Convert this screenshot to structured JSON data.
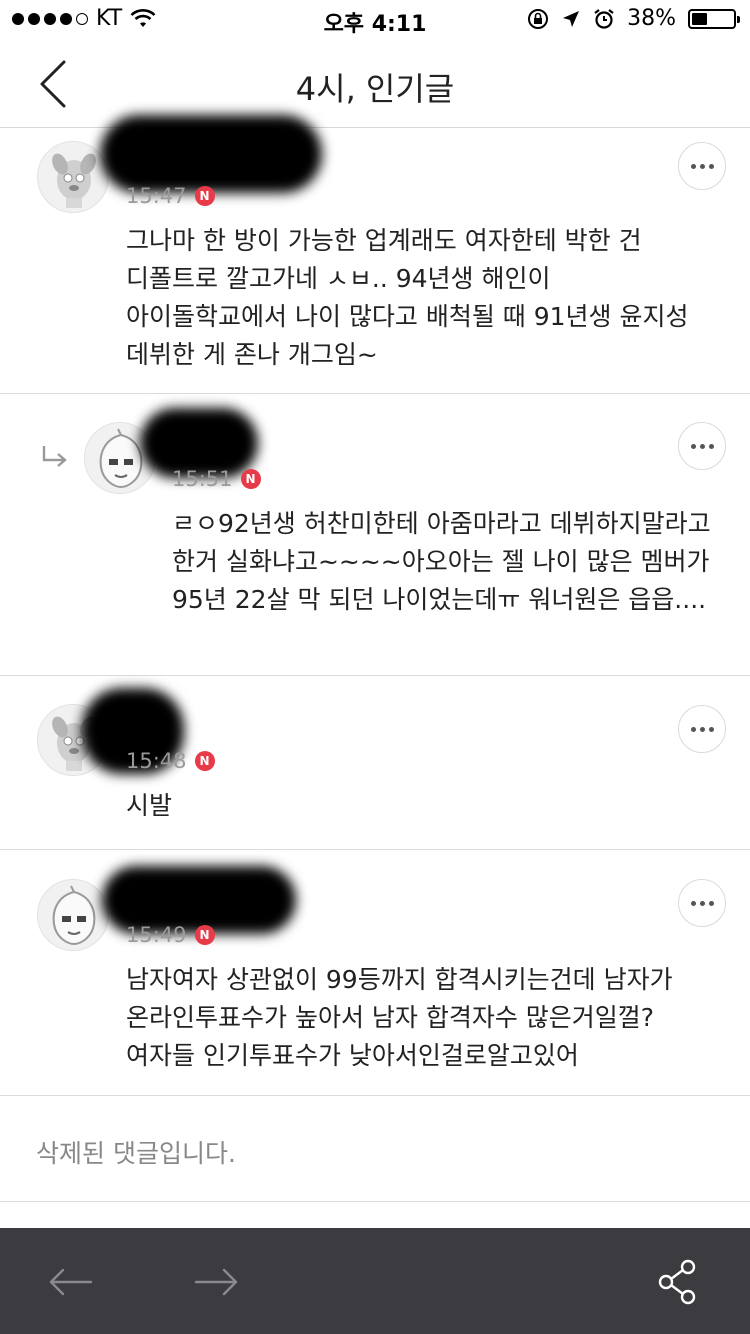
{
  "status_bar": {
    "carrier": "KT",
    "time": "오후 4:11",
    "battery_percent": "38%",
    "battery_level": 0.38
  },
  "nav": {
    "title": "4시, 인기글",
    "back_icon": "chevron-left-icon"
  },
  "comments": [
    {
      "time": "15:47",
      "badge": "N",
      "is_reply": false,
      "avatar": "dog-character-avatar",
      "text": "그나마 한 방이 가능한 업계래도 여자한테 박한 건 디폴트로 깔고가네 ㅅㅂ.. 94년생 해인이 아이돌학교에서 나이 많다고 배척될 때 91년생 윤지성 데뷔한 게 존나 개그임~"
    },
    {
      "time": "15:51",
      "badge": "N",
      "is_reply": true,
      "avatar": "peach-character-avatar",
      "text": "ㄹㅇ92년생 허찬미한테 아줌마라고 데뷔하지말라고 한거 실화냐고~~~~아오아는 젤 나이 많은 멤버가 95년 22살 막 되던 나이었는데ㅠ 워너원은 읍읍...."
    },
    {
      "time": "15:48",
      "badge": "N",
      "is_reply": false,
      "avatar": "dog-character-avatar",
      "text": "시발"
    },
    {
      "time": "15:49",
      "badge": "N",
      "is_reply": false,
      "avatar": "peach-character-avatar",
      "text": "남자여자 상관없이 99등까지 합격시키는건데 남자가 온라인투표수가 높아서 남자 합격자수 많은거일껄? 여자들 인기투표수가 낮아서인걸로알고있어"
    }
  ],
  "deleted_comment": "삭제된 댓글입니다.",
  "toolbar": {
    "back_icon": "arrow-left-icon",
    "forward_icon": "arrow-right-icon",
    "share_icon": "share-icon"
  },
  "colors": {
    "badge": "#e83b49",
    "toolbar_bg": "#3b3b40",
    "meta_text": "#9a9a9a"
  }
}
